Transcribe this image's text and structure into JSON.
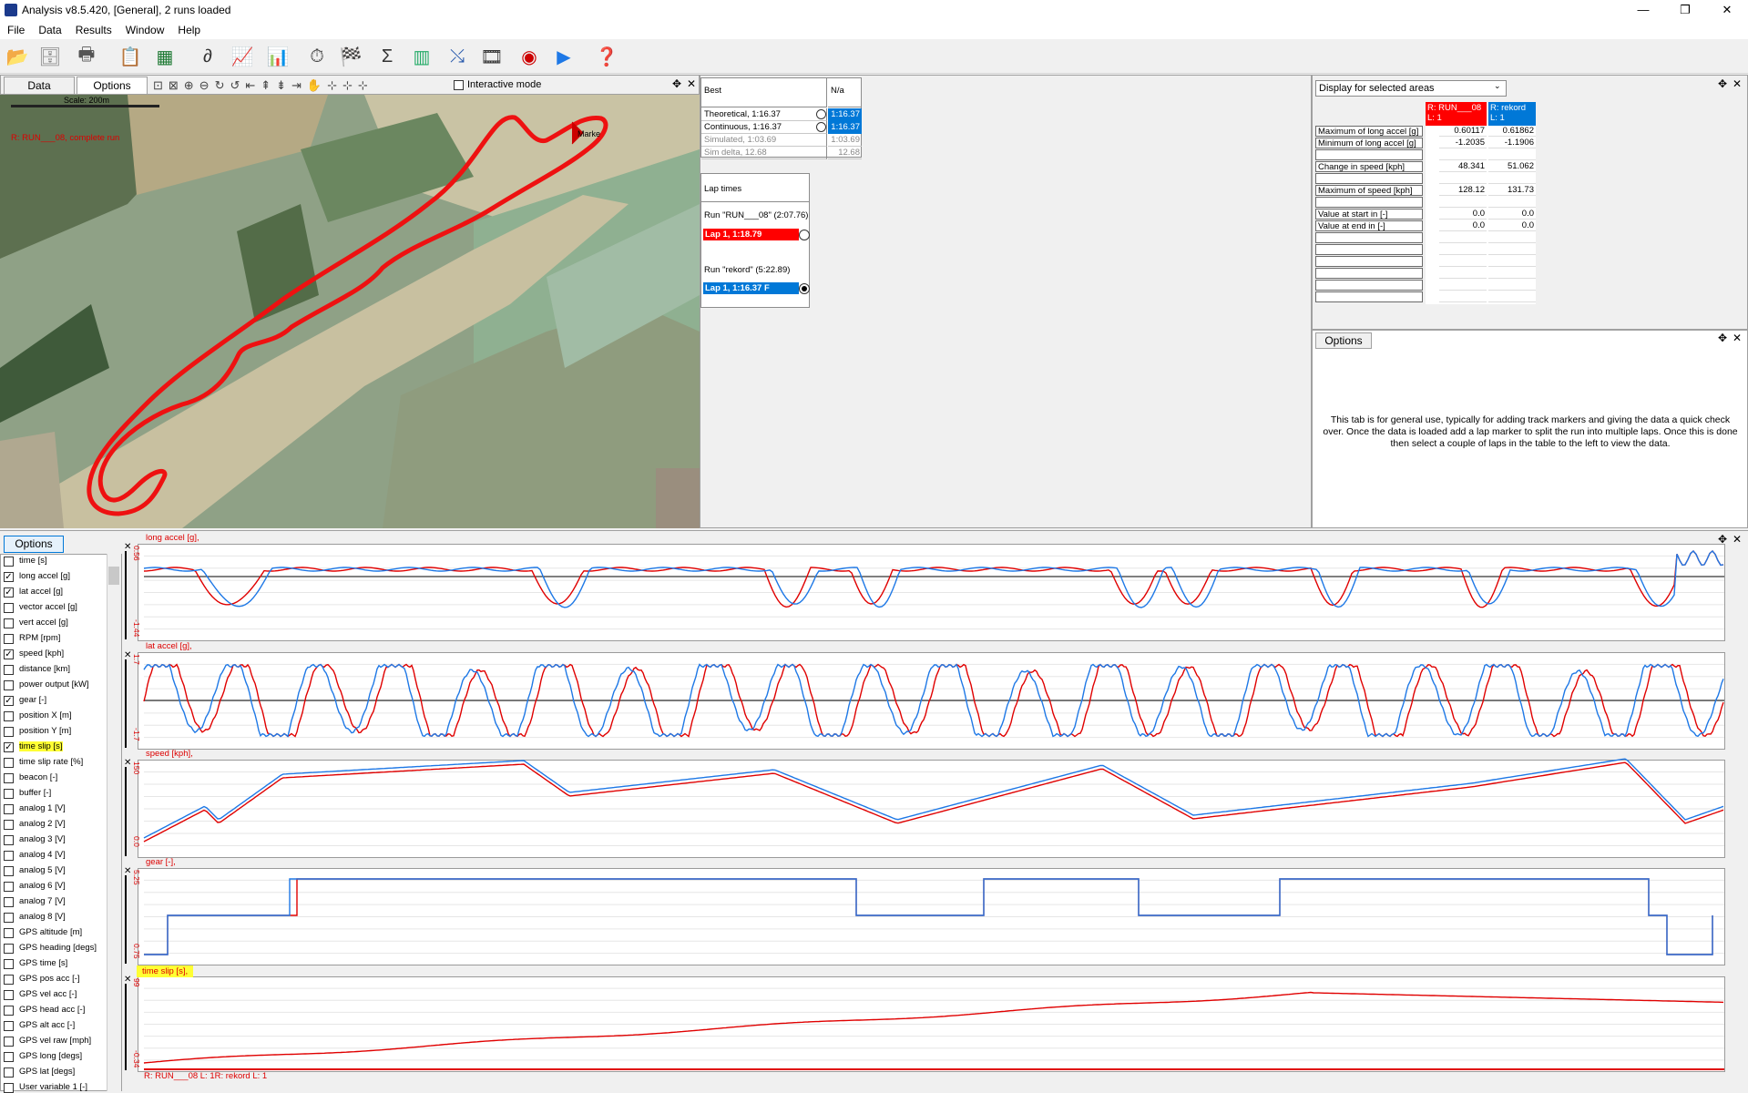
{
  "window": {
    "title": "Analysis v8.5.420, [General], 2 runs loaded",
    "controls": [
      "—",
      "❐",
      "✕"
    ]
  },
  "menu": [
    "File",
    "Data",
    "Results",
    "Window",
    "Help"
  ],
  "toolbar": {
    "icons": [
      "open-folder-icon",
      "database-icon",
      "print-icon",
      "clipboard-icon",
      "excel-export-icon",
      "track-shape-icon",
      "line-chart-icon",
      "bar-chart-icon",
      "stopwatch-icon",
      "checkered-flag-icon",
      "sigma-squared-icon",
      "histogram-icon",
      "xy-plot-icon",
      "filmstrip-icon",
      "gauge-icon",
      "play-icon",
      "help-icon"
    ]
  },
  "map_panel": {
    "tabs": [
      "Data",
      "Options"
    ],
    "interactive_mode_label": "Interactive mode",
    "scale_label": "Scale: 200m",
    "run_label": "R: RUN___08, complete run",
    "marker_label": "Marke"
  },
  "best_panel": {
    "header_left": "Best",
    "header_right": "N/a",
    "rows": [
      {
        "label": "Theoretical, 1:16.37",
        "value": "1:16.37",
        "highlight": true
      },
      {
        "label": "Continuous, 1:16.37",
        "value": "1:16.37",
        "highlight": true
      },
      {
        "label": "Simulated, 1:03.69",
        "value": "1:03.69",
        "highlight": false
      },
      {
        "label": "Sim delta, 12.68",
        "value": "12.68",
        "highlight": false
      }
    ]
  },
  "lap_times": {
    "title": "Lap times",
    "runs": [
      {
        "name": "Run \"RUN___08\" (2:07.76)",
        "lap": "Lap 1, 1:18.79",
        "color": "#ff0000"
      },
      {
        "name": "Run \"rekord\" (5:22.89)",
        "lap": "Lap 1, 1:16.37 F",
        "color": "#0078d7"
      }
    ]
  },
  "stats_panel": {
    "dropdown": "Display for selected areas",
    "col1": "R: RUN___08 L: 1",
    "col2": "R: rekord L: 1",
    "rows": [
      {
        "label": "Maximum of long accel [g]",
        "v1": "0.60117",
        "v2": "0.61862"
      },
      {
        "label": "Minimum of long accel [g]",
        "v1": "-1.2035",
        "v2": "-1.1906"
      },
      {
        "label": "",
        "v1": "",
        "v2": ""
      },
      {
        "label": "Change in speed [kph]",
        "v1": "48.341",
        "v2": "51.062"
      },
      {
        "label": "",
        "v1": "",
        "v2": ""
      },
      {
        "label": "Maximum of speed [kph]",
        "v1": "128.12",
        "v2": "131.73"
      },
      {
        "label": "",
        "v1": "",
        "v2": ""
      },
      {
        "label": "Value at start in  [-]",
        "v1": "0.0",
        "v2": "0.0"
      },
      {
        "label": "Value at end in  [-]",
        "v1": "0.0",
        "v2": "0.0"
      }
    ]
  },
  "info_panel": {
    "tab": "Options",
    "text": "This tab is for general use, typically for adding track markers and giving the data a quick check over. Once the data is loaded add a lap marker to split the run into multiple laps. Once this is done then select a couple of laps in the table to the left to view the data."
  },
  "channels": {
    "options_label": "Options",
    "items": [
      {
        "label": "time [s]",
        "checked": false
      },
      {
        "label": "long accel [g]",
        "checked": true
      },
      {
        "label": "lat accel [g]",
        "checked": true
      },
      {
        "label": "vector accel [g]",
        "checked": false
      },
      {
        "label": "vert accel [g]",
        "checked": false
      },
      {
        "label": "RPM [rpm]",
        "checked": false
      },
      {
        "label": "speed [kph]",
        "checked": true
      },
      {
        "label": "distance [km]",
        "checked": false
      },
      {
        "label": "power output [kW]",
        "checked": false
      },
      {
        "label": "gear [-]",
        "checked": true
      },
      {
        "label": "position X [m]",
        "checked": false
      },
      {
        "label": "position Y [m]",
        "checked": false
      },
      {
        "label": "time slip [s]",
        "checked": true,
        "highlight": true
      },
      {
        "label": "time slip rate [%]",
        "checked": false
      },
      {
        "label": "beacon [-]",
        "checked": false
      },
      {
        "label": "buffer [-]",
        "checked": false
      },
      {
        "label": "analog 1 [V]",
        "checked": false
      },
      {
        "label": "analog 2 [V]",
        "checked": false
      },
      {
        "label": "analog 3 [V]",
        "checked": false
      },
      {
        "label": "analog 4 [V]",
        "checked": false
      },
      {
        "label": "analog 5 [V]",
        "checked": false
      },
      {
        "label": "analog 6 [V]",
        "checked": false
      },
      {
        "label": "analog 7 [V]",
        "checked": false
      },
      {
        "label": "analog 8 [V]",
        "checked": false
      },
      {
        "label": "GPS altitude [m]",
        "checked": false
      },
      {
        "label": "GPS heading [degs]",
        "checked": false
      },
      {
        "label": "GPS time [s]",
        "checked": false
      },
      {
        "label": "GPS pos acc [-]",
        "checked": false
      },
      {
        "label": "GPS vel acc [-]",
        "checked": false
      },
      {
        "label": "GPS head acc [-]",
        "checked": false
      },
      {
        "label": "GPS alt acc [-]",
        "checked": false
      },
      {
        "label": "GPS vel raw [mph]",
        "checked": false
      },
      {
        "label": "GPS long [degs]",
        "checked": false
      },
      {
        "label": "GPS lat [degs]",
        "checked": false
      },
      {
        "label": "User variable 1 [-]",
        "checked": false
      }
    ]
  },
  "graphs": [
    {
      "label": "long accel [g],",
      "ymax": "0.56",
      "ymin": "-1.44"
    },
    {
      "label": "lat accel [g],",
      "ymax": "1.7",
      "ymin": "-1.7"
    },
    {
      "label": "speed [kph],",
      "ymax": "150",
      "ymin": "0.0"
    },
    {
      "label": "gear [-],",
      "ymax": "5.25",
      "ymin": "0.75"
    },
    {
      "label": "time slip [s],",
      "ymax": "99",
      "ymin": "-0.34",
      "highlight": true
    }
  ],
  "footer_legend": "R: RUN___08 L: 1R: rekord L: 1",
  "colors": {
    "run1": "#e00000",
    "run2": "#1e78e6",
    "highlight": "#ffff33"
  }
}
